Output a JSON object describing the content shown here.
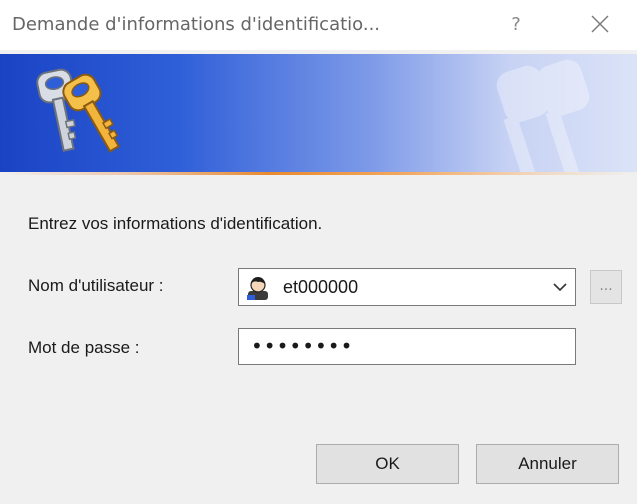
{
  "window": {
    "title": "Demande d'informations d'identificatio...",
    "help_label": "?",
    "close_icon": "close-icon"
  },
  "banner": {
    "icon": "keys-icon",
    "gradient_start": "#1a43c4",
    "gradient_end": "#dbe3f7",
    "accent": "#e98a30"
  },
  "form": {
    "prompt": "Entrez vos informations d'identification.",
    "username_label": "Nom d'utilisateur :",
    "username_value": "et000000",
    "username_icon": "user-icon",
    "browse_label": "...",
    "password_label": "Mot de passe :",
    "password_mask": "••••••••"
  },
  "buttons": {
    "ok_label": "OK",
    "cancel_label": "Annuler"
  }
}
